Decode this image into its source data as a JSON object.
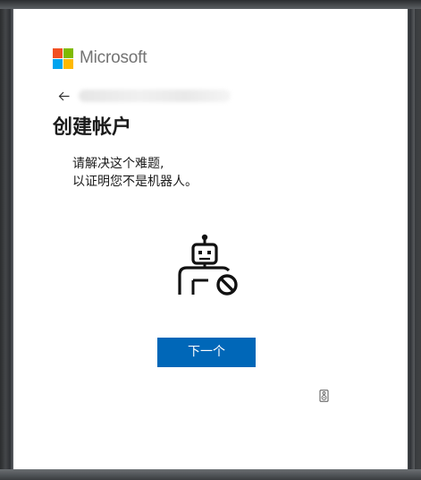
{
  "brand": {
    "name": "Microsoft",
    "logo_colors": [
      "#f25022",
      "#7fba00",
      "#00a4ef",
      "#ffb900"
    ]
  },
  "header": {
    "back_icon": "arrow-left-icon",
    "account_identity": ""
  },
  "page": {
    "title": "创建帐户",
    "description_lines": [
      "请解决这个难题,",
      "以证明您不是机器人。"
    ]
  },
  "illustration": {
    "icon": "robot-blocked-icon"
  },
  "actions": {
    "next_label": "下一个",
    "audio_icon": "speaker-icon"
  },
  "colors": {
    "accent": "#0067b8",
    "title_text": "#1b1b1b",
    "brand_text": "#737373"
  }
}
